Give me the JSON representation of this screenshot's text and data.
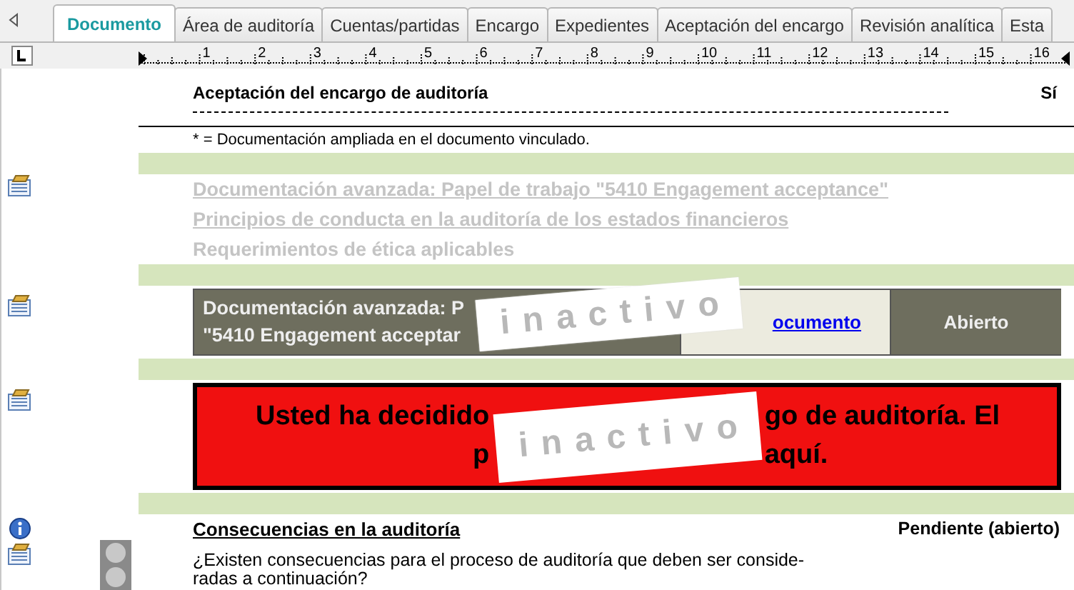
{
  "tabs": [
    {
      "label": "Documento",
      "selected": true
    },
    {
      "label": "Área de auditoría",
      "selected": false
    },
    {
      "label": "Cuentas/partidas",
      "selected": false
    },
    {
      "label": "Encargo",
      "selected": false
    },
    {
      "label": "Expedientes",
      "selected": false
    },
    {
      "label": "Aceptación del encargo",
      "selected": false
    },
    {
      "label": "Revisión analítica",
      "selected": false
    },
    {
      "label": "Esta",
      "selected": false
    }
  ],
  "ruler": {
    "numbers": [
      "1",
      "2",
      "3",
      "4",
      "5",
      "6",
      "7",
      "8",
      "9",
      "10",
      "11",
      "12",
      "13",
      "14",
      "15",
      "16"
    ]
  },
  "summary_rows": [
    {
      "label": "Aceptación del encargo de auditoría",
      "value": "Sí"
    }
  ],
  "footnote": "* = Documentación ampliada en el documento vinculado.",
  "inactive_links": [
    {
      "text": "Documentación avanzada: Papel de trabajo \"5410 Engagement acceptance\"",
      "kind": "link",
      "disabled": true
    },
    {
      "text": "Principios de conducta en la auditoría de los estados financieros",
      "kind": "link",
      "disabled": true
    },
    {
      "text": "Requerimientos de ética aplicables",
      "kind": "text",
      "disabled": true
    }
  ],
  "linked_document": {
    "title_lines": [
      "Documentación avanzada: P",
      "\"5410 Engagement acceptar"
    ],
    "link": "ocumento",
    "status": "Abierto",
    "stamp": "inactivo"
  },
  "alert": {
    "lines": [
      {
        "left": "Usted ha decidido",
        "right": "go de auditoría. El"
      },
      {
        "left": "p",
        "right": "aquí."
      }
    ],
    "stamp": "inactivo"
  },
  "section": {
    "title": "Consecuencias en la auditoría",
    "status": "Pendiente (abierto)",
    "question_lines": [
      "¿Existen consecuencias para el proceso de auditoría que deben ser conside-",
      "radas a continuación?"
    ]
  }
}
